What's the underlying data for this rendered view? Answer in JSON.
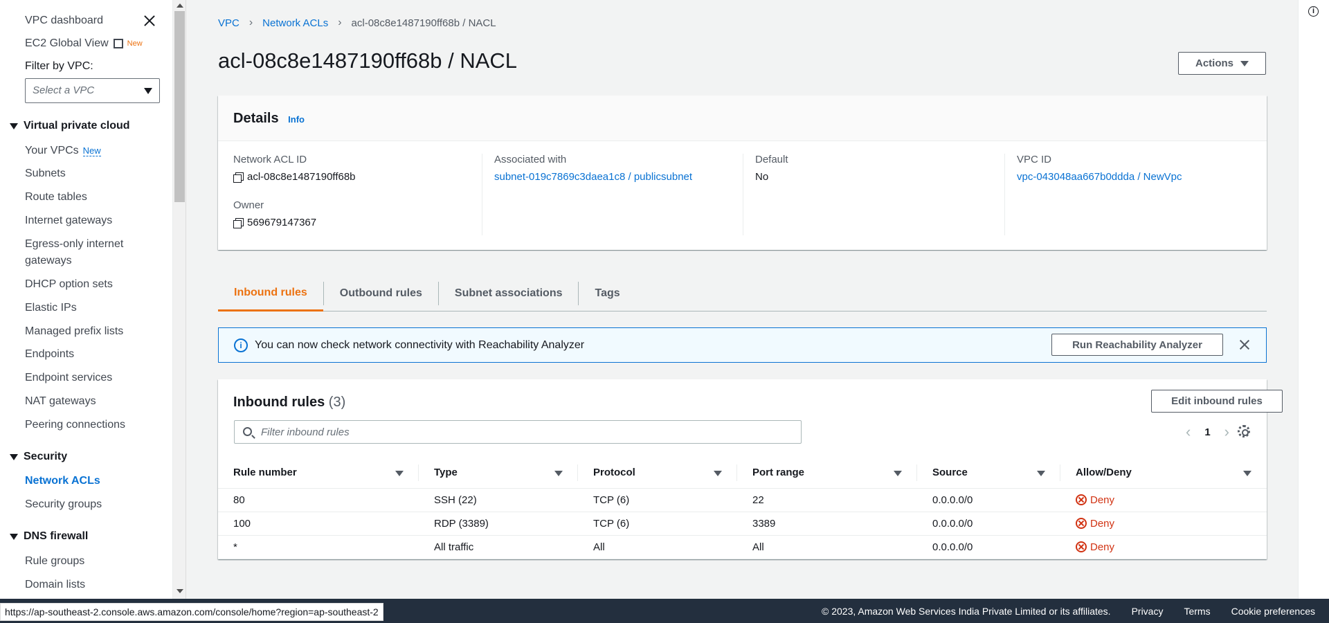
{
  "sidebar": {
    "vpc_dashboard": "VPC dashboard",
    "ec2_global_view": "EC2 Global View",
    "ec2_global_badge": "New",
    "filter_label": "Filter by VPC:",
    "filter_placeholder": "Select a VPC",
    "section_vpc": "Virtual private cloud",
    "your_vpcs": "Your VPCs",
    "your_vpcs_badge": "New",
    "subnets": "Subnets",
    "route_tables": "Route tables",
    "internet_gateways": "Internet gateways",
    "egress_line1": "Egress-only internet",
    "egress_line2": "gateways",
    "dhcp": "DHCP option sets",
    "elastic_ips": "Elastic IPs",
    "prefix_lists": "Managed prefix lists",
    "endpoints": "Endpoints",
    "endpoint_services": "Endpoint services",
    "nat_gateways": "NAT gateways",
    "peering": "Peering connections",
    "section_security": "Security",
    "network_acls": "Network ACLs",
    "security_groups": "Security groups",
    "section_dns": "DNS firewall",
    "rule_groups": "Rule groups",
    "domain_lists": "Domain lists"
  },
  "breadcrumb": {
    "vpc": "VPC",
    "nacls": "Network ACLs",
    "current": "acl-08c8e1487190ff68b / NACL"
  },
  "page_title": "acl-08c8e1487190ff68b / NACL",
  "actions_label": "Actions",
  "details": {
    "title": "Details",
    "info": "Info",
    "acl_id_label": "Network ACL ID",
    "acl_id": "acl-08c8e1487190ff68b",
    "owner_label": "Owner",
    "owner": "569679147367",
    "assoc_label": "Associated with",
    "assoc": "subnet-019c7869c3daea1c8 / publicsubnet",
    "default_label": "Default",
    "default": "No",
    "vpc_label": "VPC ID",
    "vpc": "vpc-043048aa667b0ddda / NewVpc"
  },
  "tabs": [
    "Inbound rules",
    "Outbound rules",
    "Subnet associations",
    "Tags"
  ],
  "flash": {
    "message": "You can now check network connectivity with Reachability Analyzer",
    "button": "Run Reachability Analyzer"
  },
  "rules": {
    "title": "Inbound rules",
    "count": "(3)",
    "edit_button": "Edit inbound rules",
    "filter_placeholder": "Filter inbound rules",
    "page": "1",
    "columns": [
      "Rule number",
      "Type",
      "Protocol",
      "Port range",
      "Source",
      "Allow/Deny"
    ],
    "rows": [
      [
        "80",
        "SSH (22)",
        "TCP (6)",
        "22",
        "0.0.0.0/0",
        "Deny"
      ],
      [
        "100",
        "RDP (3389)",
        "TCP (6)",
        "3389",
        "0.0.0.0/0",
        "Deny"
      ],
      [
        "*",
        "All traffic",
        "All",
        "All",
        "0.0.0.0/0",
        "Deny"
      ]
    ]
  },
  "footer": {
    "status_url": "https://ap-southeast-2.console.aws.amazon.com/console/home?region=ap-southeast-2",
    "copyright": "© 2023, Amazon Web Services India Private Limited or its affiliates.",
    "privacy": "Privacy",
    "terms": "Terms",
    "cookies": "Cookie preferences"
  },
  "colors": {
    "link": "#0972d3",
    "accent": "#ec7211",
    "deny": "#d13212",
    "footer_bg": "#232f3e"
  }
}
